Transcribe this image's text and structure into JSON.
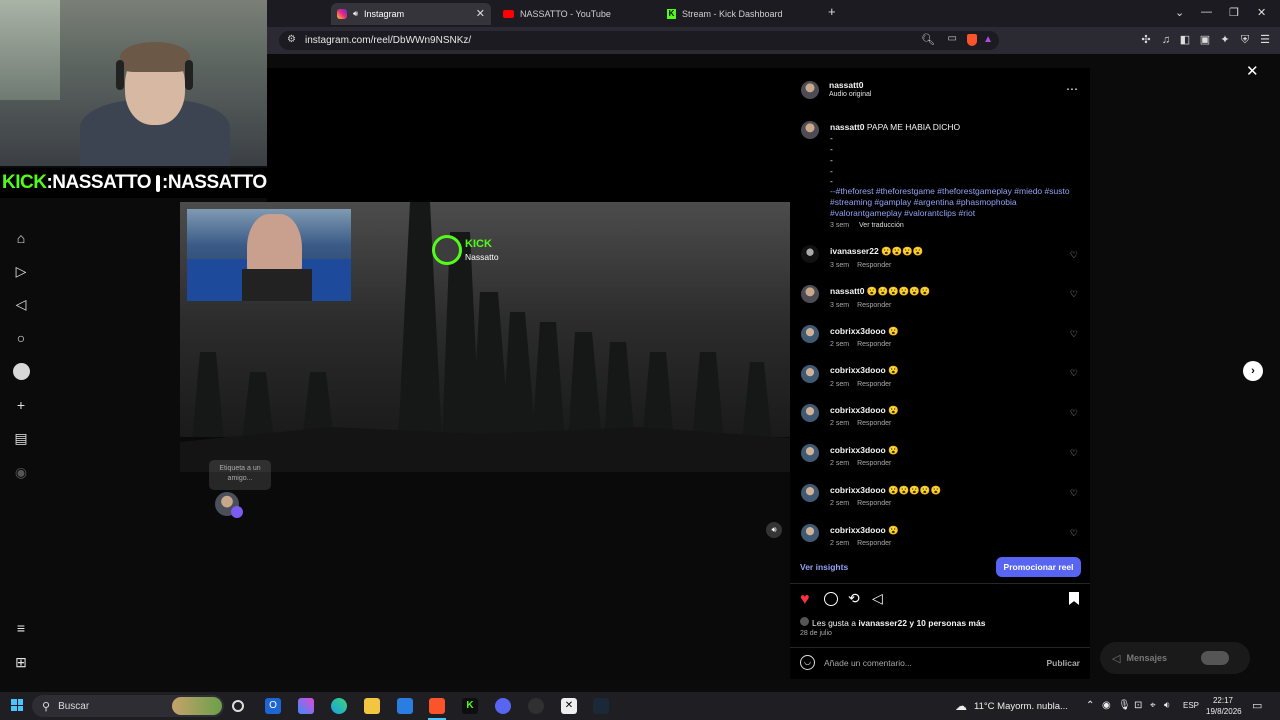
{
  "browser": {
    "tabs": [
      {
        "label": "Instagram",
        "icon": "instagram-icon",
        "active": true
      },
      {
        "label": "NASSATTO - YouTube",
        "icon": "youtube-icon",
        "active": false
      },
      {
        "label": "Stream - Kick Dashboard",
        "icon": "kick-icon",
        "active": false
      }
    ],
    "url": "instagram.com/reel/DbWWn9NSNKz/"
  },
  "stream_overlay": {
    "banner": {
      "kick": "KICK",
      "kick_handle": ":NASSATTO",
      "ig_handle": ":NASSATTO"
    },
    "kick_badge": {
      "brand": "KICK",
      "name": "Nassatto"
    },
    "tag_hint": "Etiqueta a un amigo..."
  },
  "post": {
    "username": "nassatt0",
    "audio": "Audio original",
    "caption": {
      "username": "nassatt0",
      "text": "PAPA ME HABIA DICHO",
      "dashes": [
        "-",
        "-",
        "-",
        "-",
        "-"
      ],
      "hashtags_line1": "--#theforest #theforestgame #theforestgameplay #miedo #susto",
      "hashtags_line2": "#streaming #gamplay #argentina #phasmophobia",
      "hashtags_line3": "#valorantgameplay #valorantclips #riot",
      "time": "3 sem",
      "translate": "Ver traducción"
    },
    "comments": [
      {
        "user": "ivanasser22",
        "text": "😮😮😮😮",
        "time": "3 sem",
        "reply": "Responder"
      },
      {
        "user": "nassatt0",
        "text": "😮😮😮😮😮😮",
        "time": "3 sem",
        "reply": "Responder"
      },
      {
        "user": "cobrixx3dooo",
        "text": "😮",
        "time": "2 sem",
        "reply": "Responder"
      },
      {
        "user": "cobrixx3dooo",
        "text": "😮",
        "time": "2 sem",
        "reply": "Responder"
      },
      {
        "user": "cobrixx3dooo",
        "text": "😮",
        "time": "2 sem",
        "reply": "Responder"
      },
      {
        "user": "cobrixx3dooo",
        "text": "😮",
        "time": "2 sem",
        "reply": "Responder"
      },
      {
        "user": "cobrixx3dooo",
        "text": "😮😮😮😮😮",
        "time": "2 sem",
        "reply": "Responder"
      },
      {
        "user": "cobrixx3dooo",
        "text": "😮",
        "time": "2 sem",
        "reply": "Responder"
      }
    ],
    "insights": "Ver insights",
    "promote": "Promocionar reel",
    "likes_prefix": "Les gusta a ",
    "likes_user": "ivanasser22",
    "likes_suffix": " y 10 personas más",
    "date": "28 de julio",
    "comment_placeholder": "Añade un comentario...",
    "publish": "Publicar"
  },
  "messages": {
    "label": "Mensajes"
  },
  "taskbar": {
    "search": "Buscar",
    "weather": "11°C  Mayorm. nubla...",
    "lang": "ESP",
    "time": "22:17",
    "date": "19/8/2026"
  },
  "colors": {
    "accent": "#5865f2",
    "like": "#ff3040",
    "link": "#93a3f4",
    "kick": "#53fc18"
  }
}
